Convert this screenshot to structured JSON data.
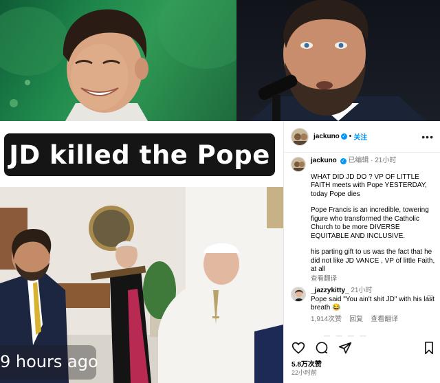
{
  "meme": {
    "caption": "JD killed the Pope",
    "time_overlay": "9 hours ago"
  },
  "post": {
    "username": "jackuno",
    "follow_label": "关注",
    "caption": {
      "username": "jackuno",
      "meta": "已编辑 · 21小时",
      "paragraphs": [
        "WHAT DID JD DO ? VP OF LITTLE FAITH meets with Pope YESTERDAY, today Pope dies",
        "Pope Francis is an incredible, towering figure who transformed the Catholic Church to be more DIVERSE EQUITABLE AND INCLUSIVE.",
        "his parting gift to us was the fact that he did not like JD VANCE , VP of little Faith, at all"
      ],
      "translate_label": "查看翻译"
    },
    "comment": {
      "username": "_jazzykitty_",
      "time": "21小时",
      "text": "Pope said \"You ain't shit JD\" with his last breath 😂",
      "likes": "1,914次赞",
      "reply_label": "回复",
      "translate_label": "查看翻译"
    },
    "likes_total": "5.8万次赞",
    "posted": "22小时前"
  },
  "icons": {
    "more": "more-horizontal-icon",
    "verified": "verified-badge-icon",
    "like": "heart-icon",
    "comment": "comment-bubble-icon",
    "share": "paper-plane-icon",
    "save": "bookmark-icon"
  },
  "colors": {
    "link_blue": "#0095f6",
    "meta_gray": "#737373",
    "caption_bg": "#151515"
  }
}
